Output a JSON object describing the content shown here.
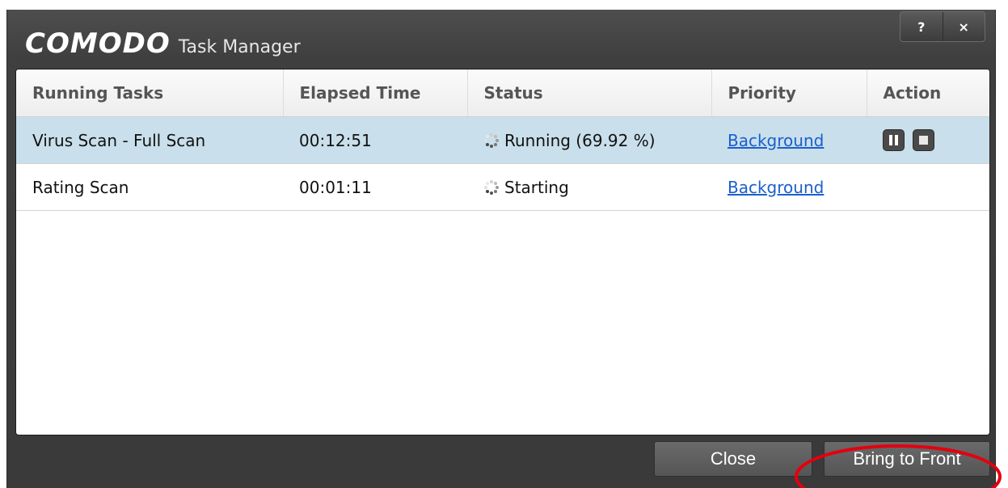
{
  "window": {
    "brand": "COMODO",
    "title": "Task Manager",
    "help_label": "?",
    "close_label": "×"
  },
  "table": {
    "columns": [
      "Running Tasks",
      "Elapsed Time",
      "Status",
      "Priority",
      "Action"
    ],
    "rows": [
      {
        "task": "Virus Scan - Full Scan",
        "elapsed": "00:12:51",
        "status": "Running (69.92 %)",
        "priority": "Background",
        "selected": true,
        "actions": [
          "pause-icon",
          "stop-icon"
        ]
      },
      {
        "task": "Rating Scan",
        "elapsed": "00:01:11",
        "status": "Starting",
        "priority": "Background",
        "selected": false,
        "actions": []
      }
    ]
  },
  "footer": {
    "close_label": "Close",
    "bring_to_front_label": "Bring to Front"
  },
  "colors": {
    "selection": "#c9dfeb",
    "link": "#1b5fcc",
    "annotation_ellipse": "#e3000f"
  }
}
